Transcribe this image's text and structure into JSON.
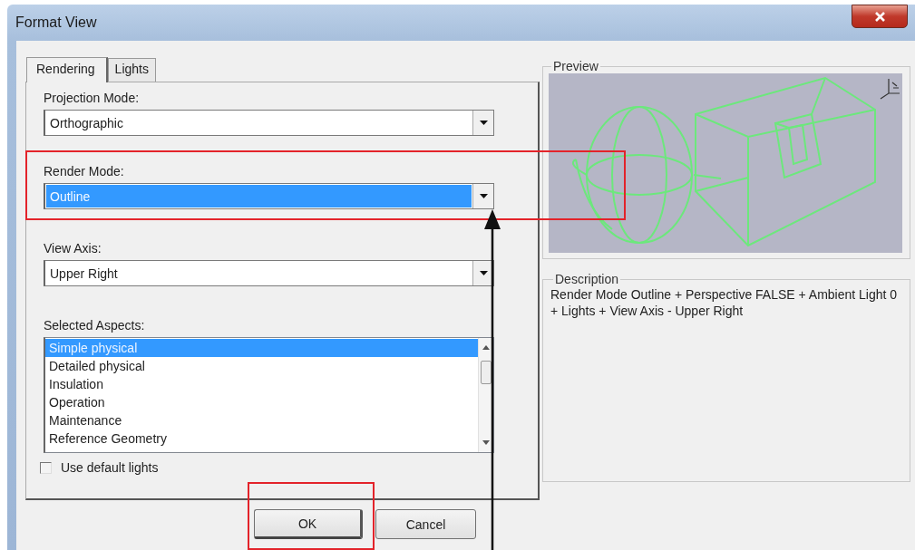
{
  "window": {
    "title": "Format View"
  },
  "tabs": [
    {
      "label": "Rendering",
      "selected": true
    },
    {
      "label": "Lights",
      "selected": false
    }
  ],
  "fields": [
    {
      "label": "Projection Mode:",
      "value": "Orthographic",
      "highlighted": false
    },
    {
      "label": "Render Mode:",
      "value": "Outline",
      "highlighted": true
    },
    {
      "label": "View Axis:",
      "value": "Upper Right",
      "highlighted": false
    }
  ],
  "aspects": {
    "label": "Selected Aspects:",
    "items": [
      {
        "label": "Simple physical",
        "selected": true
      },
      {
        "label": "Detailed physical",
        "selected": false
      },
      {
        "label": "Insulation",
        "selected": false
      },
      {
        "label": "Operation",
        "selected": false
      },
      {
        "label": "Maintenance",
        "selected": false
      },
      {
        "label": "Reference Geometry",
        "selected": false
      }
    ]
  },
  "default_lights": {
    "label": "Use default lights",
    "checked": false
  },
  "preview": {
    "title": "Preview"
  },
  "description": {
    "title": "Description",
    "text": "Render Mode Outline + Perspective FALSE + Ambient Light 0 + Lights + View Axis - Upper Right"
  },
  "buttons": [
    {
      "label": "OK"
    },
    {
      "label": "Cancel"
    }
  ],
  "annotations": [
    {
      "kind": "box"
    },
    {
      "kind": "box"
    },
    {
      "kind": "arrow"
    }
  ]
}
